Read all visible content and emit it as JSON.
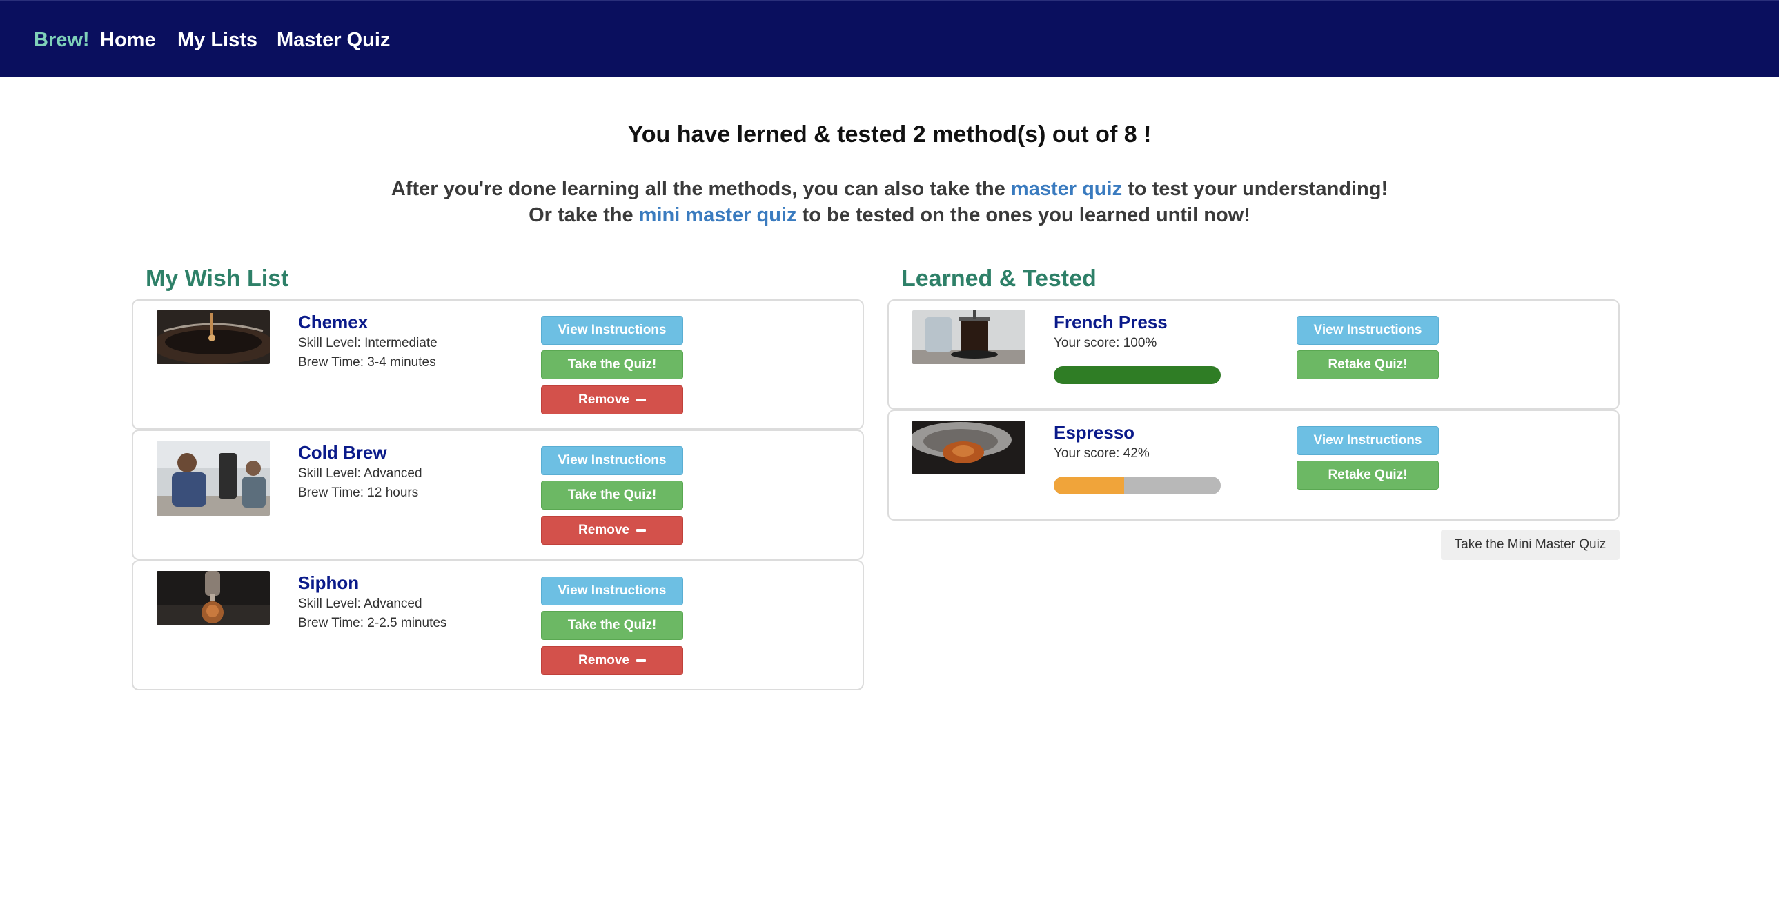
{
  "nav": {
    "brand": "Brew!",
    "links": [
      "Home",
      "My Lists",
      "Master Quiz"
    ]
  },
  "summary": {
    "headline": "You have lerned & tested 2 method(s) out of 8 !",
    "line1_before": "After you're done learning all the methods, you can also take the ",
    "line1_link": "master quiz",
    "line1_after": " to test your understanding!",
    "line2_before": "Or take the ",
    "line2_link": "mini master quiz",
    "line2_after": " to be tested on the ones you learned until now!"
  },
  "wishlist": {
    "title": "My Wish List",
    "items": [
      {
        "name": "Chemex",
        "skill": "Skill Level: Intermediate",
        "time": "Brew Time: 3-4 minutes",
        "view": "View Instructions",
        "quiz": "Take the Quiz!",
        "remove": "Remove"
      },
      {
        "name": "Cold Brew",
        "skill": "Skill Level: Advanced",
        "time": "Brew Time: 12 hours",
        "view": "View Instructions",
        "quiz": "Take the Quiz!",
        "remove": "Remove"
      },
      {
        "name": "Siphon",
        "skill": "Skill Level: Advanced",
        "time": "Brew Time: 2-2.5 minutes",
        "view": "View Instructions",
        "quiz": "Take the Quiz!",
        "remove": "Remove"
      }
    ]
  },
  "learned": {
    "title": "Learned & Tested",
    "items": [
      {
        "name": "French Press",
        "score": "Your score: 100%",
        "score_fraction": 1.0,
        "view": "View Instructions",
        "retake": "Retake Quiz!"
      },
      {
        "name": "Espresso",
        "score": "Your score: 42%",
        "score_fraction": 0.42,
        "view": "View Instructions",
        "retake": "Retake Quiz!"
      }
    ],
    "mini_quiz_button": "Take the Mini Master Quiz"
  },
  "colors": {
    "navbar": "#0a0f5e",
    "brand": "#7fd1b9",
    "section_title": "#2e8068",
    "item_name": "#0a1a8a",
    "link": "#3a7bbf",
    "progress_full": "#2f7d25",
    "progress_partial": "#f0a43a"
  }
}
